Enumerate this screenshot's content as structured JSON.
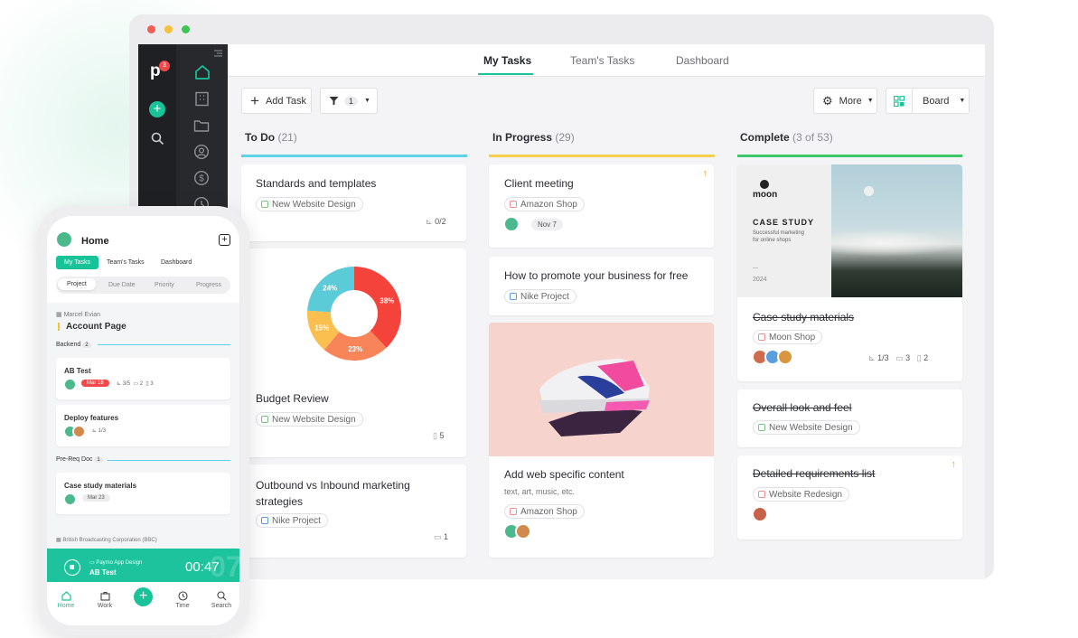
{
  "app": {
    "badge": "3",
    "logo_letter": "p"
  },
  "tabs": [
    {
      "label": "My Tasks"
    },
    {
      "label": "Team's Tasks"
    },
    {
      "label": "Dashboard"
    }
  ],
  "toolbar": {
    "add_task": "Add Task",
    "filter_count": "1",
    "more": "More",
    "view": "Board"
  },
  "colors": {
    "accent": "#19c39a",
    "todo": "#61d1e8",
    "progress": "#f7cf4c",
    "complete": "#3cc76a"
  },
  "columns": {
    "todo": {
      "title": "To Do",
      "count": "(21)"
    },
    "progress": {
      "title": "In Progress",
      "count": "(29)"
    },
    "complete": {
      "title": "Complete",
      "count": "(3 of 53)"
    }
  },
  "cards": {
    "standards": {
      "title": "Standards and templates",
      "tag": "New Website Design",
      "subtasks": "0/2"
    },
    "budget": {
      "title": "Budget Review",
      "tag": "New Website Design",
      "files": "5"
    },
    "outbound": {
      "title": "Outbound vs Inbound marketing strategies",
      "tag": "Nike Project",
      "comments": "1"
    },
    "client": {
      "title": "Client meeting",
      "tag": "Amazon Shop",
      "date": "Nov 7"
    },
    "promote": {
      "title": "How to promote your business for free",
      "tag": "Nike Project"
    },
    "addweb": {
      "title": "Add web specific content",
      "subtitle": "text, art, music, etc.",
      "tag": "Amazon Shop"
    },
    "casestudy": {
      "title": "Case study materials",
      "tag": "Moon Shop",
      "subtasks": "1/3",
      "comments": "3",
      "files": "2",
      "cover": {
        "brand": "moon",
        "heading": "CASE STUDY",
        "text1": "Successful marketing",
        "text2": "for online shops",
        "dash": "—",
        "year": "2024"
      }
    },
    "overall": {
      "title": "Overall look and feel",
      "tag": "New Website Design"
    },
    "detailed": {
      "title": "Detailed requirements list",
      "tag": "Website Redesign"
    }
  },
  "chart_data": {
    "type": "pie",
    "categories": [
      "38%",
      "23%",
      "15%",
      "24%"
    ],
    "values": [
      38,
      23,
      15,
      24
    ],
    "colors": [
      "#f4433a",
      "#f8855a",
      "#fbbf4f",
      "#5ccbd8"
    ]
  },
  "phone": {
    "title": "Home",
    "tabs": [
      {
        "label": "My Tasks"
      },
      {
        "label": "Team's Tasks"
      },
      {
        "label": "Dashboard"
      }
    ],
    "filters": [
      {
        "label": "Project"
      },
      {
        "label": "Due Date"
      },
      {
        "label": "Priority"
      },
      {
        "label": "Progress"
      }
    ],
    "client": "Marcel Evian",
    "project": "Account Page",
    "group1": {
      "label": "Backend",
      "count": "2"
    },
    "ab": {
      "title": "AB Test",
      "date": "Mar 18",
      "subtasks": "3/5",
      "comments": "2",
      "files": "3"
    },
    "deploy": {
      "title": "Deploy features",
      "subtasks": "1/3"
    },
    "group2": {
      "label": "Pre-Req Doc",
      "count": "1"
    },
    "casestudy": {
      "title": "Case study materials",
      "date": "Mar 23"
    },
    "client2": "British Broadcasting Corporation (BBC)",
    "timer": {
      "project": "Paymo App Design",
      "task": "AB Test",
      "time": "00:47",
      "ghost": "07"
    },
    "nav": [
      {
        "label": "Home"
      },
      {
        "label": "Work"
      },
      {
        "label": ""
      },
      {
        "label": "Time"
      },
      {
        "label": "Search"
      }
    ]
  }
}
